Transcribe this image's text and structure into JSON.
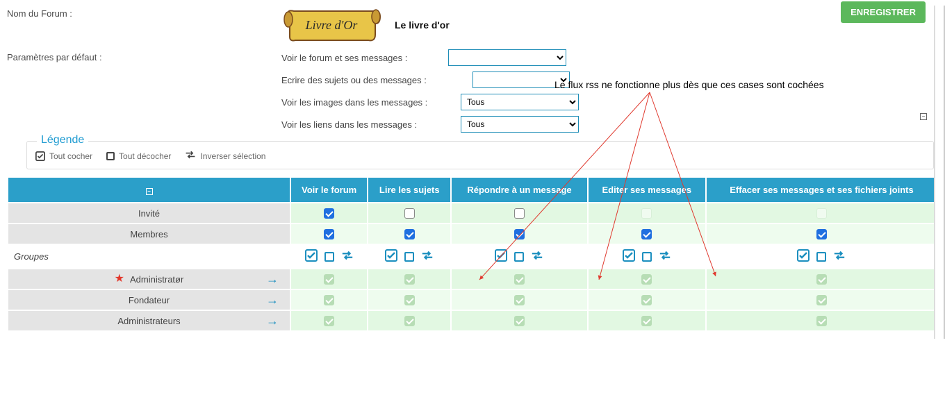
{
  "buttons": {
    "save": "ENREGISTRER"
  },
  "fields": {
    "forum_name_label": "Nom du Forum :",
    "forum_name_value": "Le livre d'or",
    "scroll_text": "Livre d'Or",
    "defaults_label": "Paramètres par défaut :",
    "param1_label": "Voir le forum et ses messages :",
    "param1_value": "",
    "param2_label": "Ecrire des sujets ou des messages :",
    "param2_value": "",
    "param3_label": "Voir les images dans les messages :",
    "param3_value": "Tous",
    "param4_label": "Voir les liens dans les messages :",
    "param4_value": "Tous"
  },
  "annotation": "Le flux rss ne fonctionne plus dès que ces cases sont cochées",
  "legende": {
    "title": "Légende",
    "check_all": "Tout cocher",
    "uncheck_all": "Tout décocher",
    "invert": "Inverser sélection"
  },
  "table": {
    "headers": [
      "",
      "Voir le forum",
      "Lire les sujets",
      "Répondre à un message",
      "Editer ses messages",
      "Effacer ses messages et ses fichiers joints"
    ],
    "rows": {
      "invite": "Invité",
      "membres": "Membres",
      "groupes": "Groupes",
      "administrator": "Administratør",
      "fondateur": "Fondateur",
      "administrateurs": "Administrateurs"
    }
  }
}
